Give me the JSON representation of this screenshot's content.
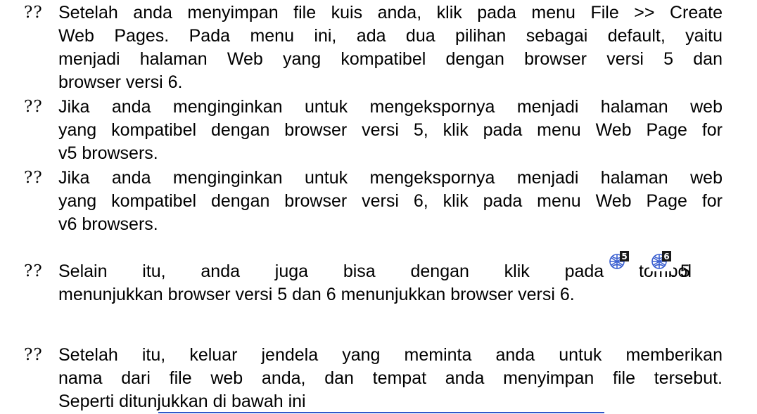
{
  "bullet_glyph": "??",
  "items": [
    {
      "lines": [
        "Setelah anda menyimpan file kuis anda, klik pada menu File >> Create",
        "Web Pages. Pada menu ini, ada dua pilihan sebagai default, yaitu",
        "menjadi halaman Web yang kompatibel dengan browser versi 5 dan",
        "browser versi 6."
      ]
    },
    {
      "lines": [
        "Jika anda menginginkan untuk mengekspornya menjadi halaman web",
        "yang kompatibel dengan browser versi 5, klik pada menu Web Page for",
        "v5 browsers."
      ]
    },
    {
      "lines": [
        "Jika anda menginginkan untuk mengekspornya menjadi halaman web",
        "yang kompatibel dengan browser versi 6, klik pada menu Web Page for",
        "v6 browsers."
      ]
    },
    {
      "line1_before": "Selain itu, anda juga bisa dengan klik pada tombol",
      "line1_after": ". 5",
      "line2": "menunjukkan browser versi 5 dan 6 menunjukkan browser versi 6.",
      "icons": [
        {
          "name": "web-page-v5-icon",
          "digit": "5"
        },
        {
          "name": "web-page-v6-icon",
          "digit": "6"
        }
      ]
    },
    {
      "lines": [
        "Setelah itu, keluar jendela yang meminta anda untuk memberikan",
        "nama dari file web anda, dan tempat anda menyimpan file tersebut.",
        "Seperti ditunjukkan di bawah ini"
      ]
    }
  ],
  "colors": {
    "text": "#000000",
    "icon_blue": "#3a5fd0",
    "rule": "#2f56c9"
  }
}
